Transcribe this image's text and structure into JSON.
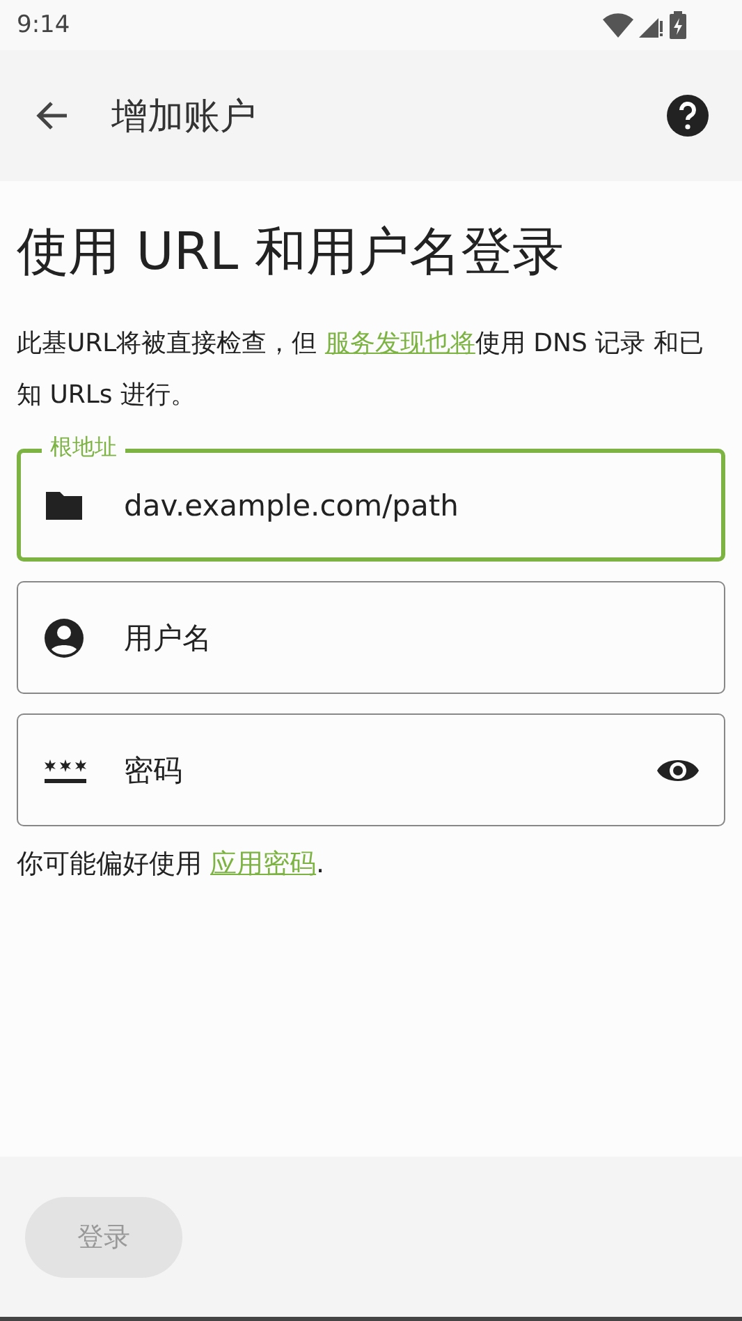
{
  "status_bar": {
    "time": "9:14"
  },
  "app_bar": {
    "title": "增加账户"
  },
  "heading": "使用 URL 和用户名登录",
  "description": {
    "before": "此基URL将被直接检查，但 ",
    "link": "服务发现也将",
    "after": "使用 DNS 记录 和已知 URLs 进行。"
  },
  "fields": [
    {
      "kind": "folder",
      "label": "根地址",
      "value": "dav.example.com/path",
      "focused": true
    },
    {
      "kind": "person",
      "placeholder": "用户名",
      "focused": false
    },
    {
      "kind": "password",
      "placeholder": "密码",
      "focused": false,
      "reveal_toggle": true
    }
  ],
  "hint": {
    "before": "你可能偏好使用 ",
    "link": "应用密码",
    "after": "."
  },
  "login_button": {
    "label": "登录",
    "disabled": true
  }
}
